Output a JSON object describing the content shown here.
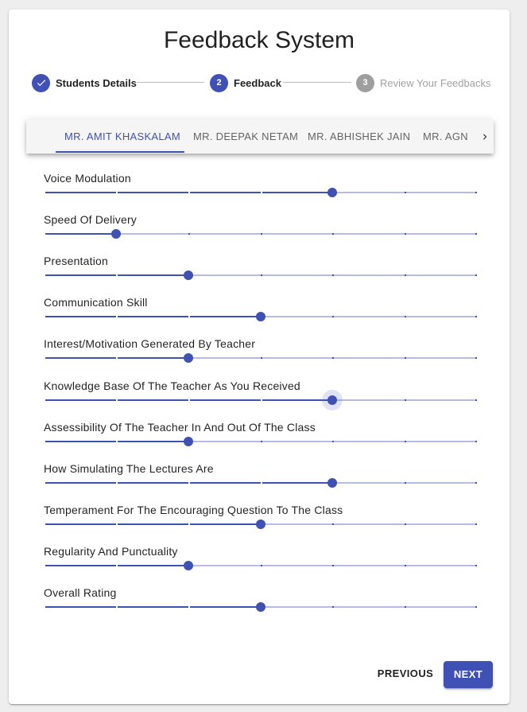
{
  "title": "Feedback System",
  "stepper": {
    "steps": [
      {
        "label": "Students Details",
        "number": "1",
        "state": "completed",
        "icon": "check-icon"
      },
      {
        "label": "Feedback",
        "number": "2",
        "state": "active"
      },
      {
        "label": "Review Your Feedbacks",
        "number": "3",
        "state": "inactive"
      }
    ]
  },
  "tabs": {
    "items": [
      {
        "label": "MR. AMIT KHASKALAM",
        "active": true
      },
      {
        "label": "MR. DEEPAK NETAM",
        "active": false
      },
      {
        "label": "MR. ABHISHEK JAIN",
        "active": false
      },
      {
        "label": "MR. AGN",
        "active": false
      }
    ],
    "scroll_icon": "chevron-right-icon"
  },
  "criteria": [
    {
      "label": "Voice Modulation",
      "value": 4,
      "max": 6
    },
    {
      "label": "Speed Of Delivery",
      "value": 1,
      "max": 6
    },
    {
      "label": "Presentation",
      "value": 2,
      "max": 6
    },
    {
      "label": "Communication Skill",
      "value": 3,
      "max": 6
    },
    {
      "label": "Interest/Motivation Generated By Teacher",
      "value": 2,
      "max": 6
    },
    {
      "label": "Knowledge Base Of The Teacher As You Received",
      "value": 4,
      "max": 6,
      "focused": true
    },
    {
      "label": "Assessibility Of The Teacher In And Out Of The Class",
      "value": 2,
      "max": 6
    },
    {
      "label": "How Simulating The Lectures Are",
      "value": 4,
      "max": 6
    },
    {
      "label": "Temperament For The Encouraging Question To The Class",
      "value": 3,
      "max": 6
    },
    {
      "label": "Regularity And Punctuality",
      "value": 2,
      "max": 6
    },
    {
      "label": "Overall Rating",
      "value": 3,
      "max": 6
    }
  ],
  "buttons": {
    "previous": "PREVIOUS",
    "next": "NEXT"
  },
  "colors": {
    "primary": "#3f51b5",
    "inactive_step": "#9e9e9e"
  }
}
